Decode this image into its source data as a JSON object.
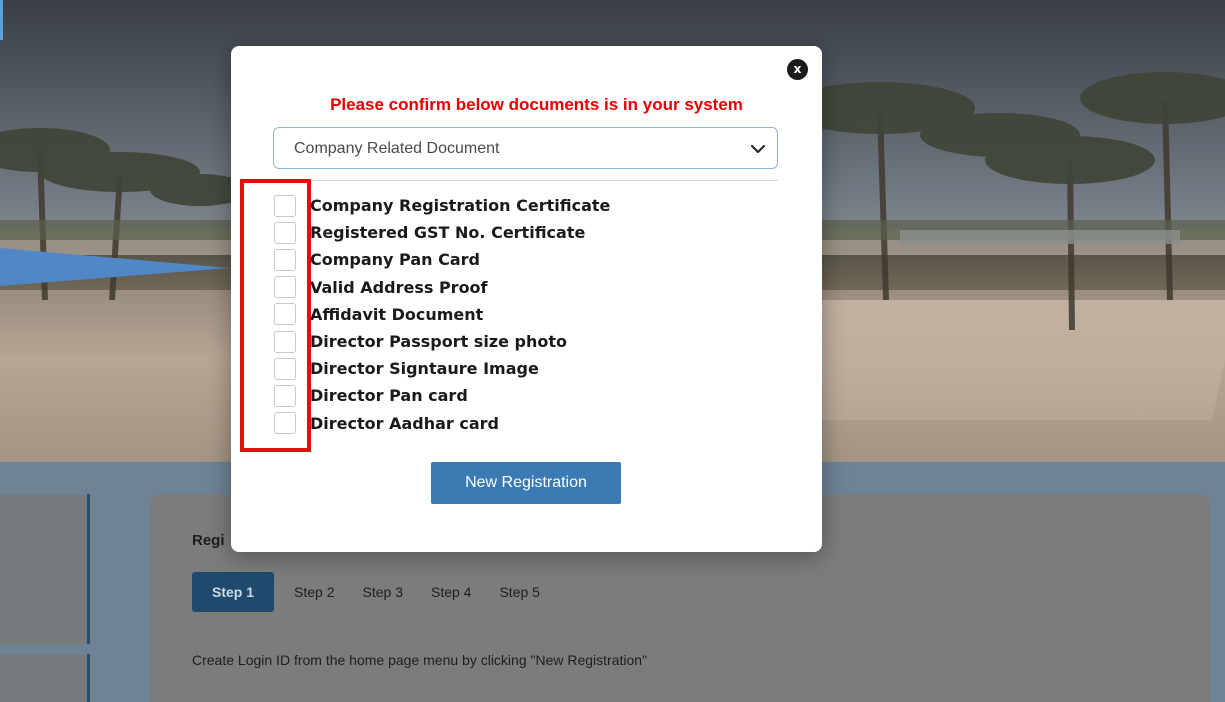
{
  "modal": {
    "close_label": "x",
    "title": "Please confirm below documents is in your system",
    "select": {
      "value": "Company Related Document"
    },
    "documents": [
      "Company Registration Certificate",
      "Registered GST No. Certificate",
      "Company Pan Card",
      "Valid Address Proof",
      "Affidavit Document",
      "Director Passport size photo",
      "Director Signtaure Image",
      "Director Pan card",
      "Director Aadhar card"
    ],
    "button_label": "New Registration"
  },
  "page": {
    "registration_heading": "Regi",
    "steps": [
      "Step 1",
      "Step 2",
      "Step 3",
      "Step 4",
      "Step 5"
    ],
    "active_step": "Step 1",
    "note": "Create Login ID from the home page menu by clicking \"New Registration\""
  },
  "colors": {
    "title_red": "#e60000",
    "highlight_red": "#e31010",
    "button_blue": "#3b7ab3",
    "active_step_bg": "#1f4a6e"
  }
}
